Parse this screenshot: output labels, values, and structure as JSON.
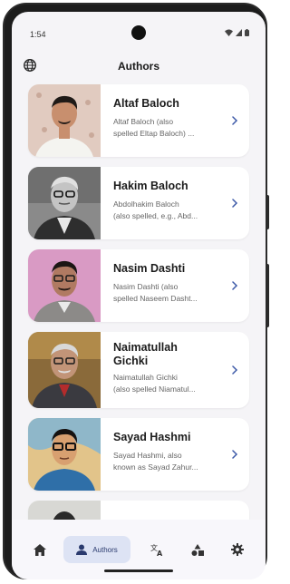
{
  "status": {
    "time": "1:54"
  },
  "header": {
    "title": "Authors",
    "globe_icon": "globe-icon"
  },
  "authors": [
    {
      "name": "Altaf Baloch",
      "desc1": "Altaf Baloch (also",
      "desc2": "spelled Eltap Baloch) ..."
    },
    {
      "name": "Hakim Baloch",
      "desc1": "Abdolhakim Baloch",
      "desc2": "(also spelled, e.g., Abd..."
    },
    {
      "name": "Nasim Dashti",
      "desc1": "Nasim Dashti (also",
      "desc2": "spelled Naseem Dasht..."
    },
    {
      "name1": "Naimatullah",
      "name2": "Gichki",
      "desc1": "Naimatullah Gichki",
      "desc2": "(also spelled Niamatul..."
    },
    {
      "name": "Sayad Hashmi",
      "desc1": "Sayad Hashmi, also",
      "desc2": "known as Sayad Zahur..."
    }
  ],
  "nav": {
    "items": [
      "home-icon",
      "person-icon",
      "translate-icon",
      "shapes-icon",
      "gear-icon"
    ],
    "active_label": "Authors"
  },
  "colors": {
    "accent": "#3d5aa8",
    "active_pill": "#dde3f4"
  }
}
